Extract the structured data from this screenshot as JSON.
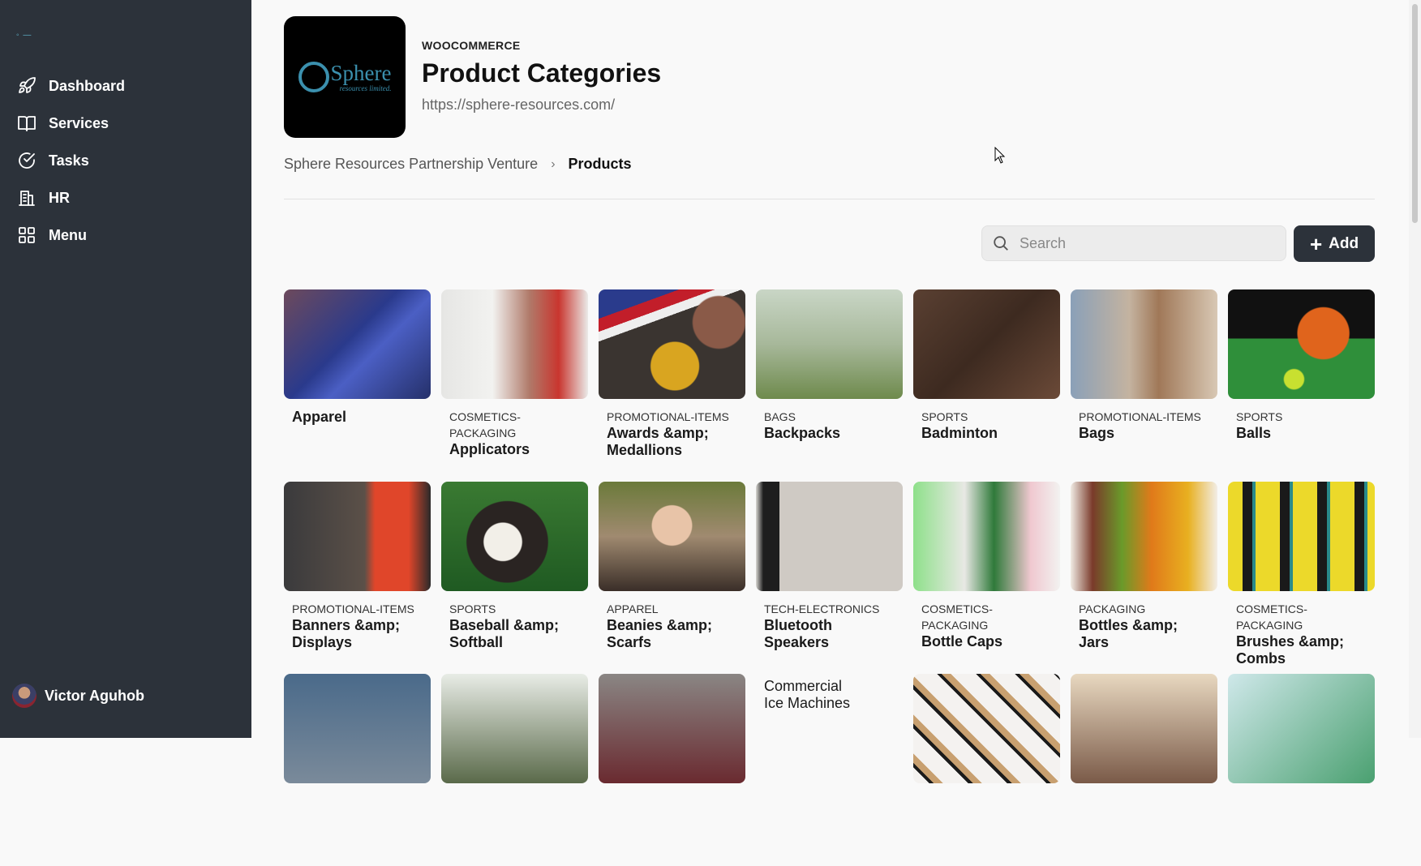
{
  "sidebar": {
    "items": [
      {
        "label": "Dashboard",
        "icon": "rocket-icon"
      },
      {
        "label": "Services",
        "icon": "book-icon"
      },
      {
        "label": "Tasks",
        "icon": "check-circle-icon"
      },
      {
        "label": "HR",
        "icon": "building-icon"
      },
      {
        "label": "Menu",
        "icon": "grid-icon"
      }
    ],
    "user": {
      "name": "Victor Aguhob"
    }
  },
  "header": {
    "eyebrow": "WOOCOMMERCE",
    "title": "Product Categories",
    "url": "https://sphere-resources.com/",
    "logo_text": "Sphere",
    "logo_sub": "resources limited."
  },
  "breadcrumb": {
    "parent": "Sphere Resources Partnership Venture",
    "separator": "›",
    "current": "Products"
  },
  "search": {
    "placeholder": "Search"
  },
  "add_button": {
    "label": "Add",
    "icon": "plus-icon"
  },
  "categories": [
    {
      "category": "",
      "name": "Apparel"
    },
    {
      "category": "COSMETICS-PACKAGING",
      "name": "Applicators"
    },
    {
      "category": "PROMOTIONAL-ITEMS",
      "name": "Awards &amp; Medallions"
    },
    {
      "category": "BAGS",
      "name": "Backpacks"
    },
    {
      "category": "SPORTS",
      "name": "Badminton"
    },
    {
      "category": "PROMOTIONAL-ITEMS",
      "name": "Bags"
    },
    {
      "category": "SPORTS",
      "name": "Balls"
    },
    {
      "category": "PROMOTIONAL-ITEMS",
      "name": "Banners &amp; Displays"
    },
    {
      "category": "SPORTS",
      "name": "Baseball &amp; Softball"
    },
    {
      "category": "APPAREL",
      "name": "Beanies &amp; Scarfs"
    },
    {
      "category": "TECH-ELECTRONICS",
      "name": "Bluetooth Speakers"
    },
    {
      "category": "COSMETICS-PACKAGING",
      "name": "Bottle Caps"
    },
    {
      "category": "PACKAGING",
      "name": "Bottles &amp; Jars"
    },
    {
      "category": "COSMETICS-PACKAGING",
      "name": "Brushes &amp; Combs"
    },
    {
      "category": "",
      "name": ""
    },
    {
      "category": "",
      "name": ""
    },
    {
      "category": "",
      "name": ""
    },
    {
      "category": "",
      "name": "Commercial Ice Machines"
    },
    {
      "category": "",
      "name": ""
    },
    {
      "category": "",
      "name": ""
    },
    {
      "category": "",
      "name": ""
    }
  ],
  "colors": {
    "sidebar_bg": "#2c323a",
    "page_bg": "#f9f9f9",
    "button_bg": "#2c323a"
  }
}
